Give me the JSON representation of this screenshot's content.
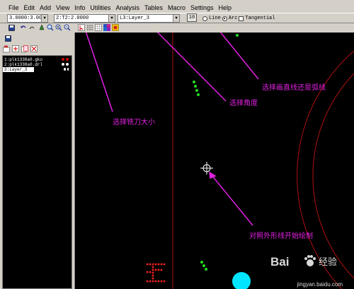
{
  "menu": {
    "items": [
      "File",
      "Edit",
      "Add",
      "View",
      "Info",
      "Utilities",
      "Analysis",
      "Tables",
      "Macro",
      "Settings",
      "Help"
    ]
  },
  "toolbar": {
    "aperture_value": "3.0000:3.0000",
    "tool_value": "2:T2:2.0000",
    "layer_value": "L3:Layer_3",
    "step_value": "10",
    "line_label": "Line",
    "arc_label": "Arc",
    "tangential_label": "Tangential",
    "selected_mode": "Arc",
    "tangential_checked": false
  },
  "layers": [
    {
      "label": "1:plk1338a0.gko",
      "selected": false,
      "dot_colors": [
        "#c00000",
        "#c00000"
      ]
    },
    {
      "label": "2:plk1338a0.drl",
      "selected": false,
      "dot_colors": [
        "#ffffff",
        "#ffffff"
      ]
    },
    {
      "label": "3:Layer_3",
      "selected": true,
      "dot_colors": [
        "#ffffff",
        "#ffffff"
      ]
    }
  ],
  "annotations": {
    "tool_size": "选择铣刀大小",
    "line_or_arc": "选择画直线还是弧线",
    "angle": "选择角度",
    "outline": "对照外形线开始绘制"
  },
  "watermark": {
    "site": "jingyan.baidu.com",
    "brand": "Baidu 经验"
  },
  "colors": {
    "annotation": "#e021e0",
    "outline": "#b01010",
    "drill_dots": "#22dd22",
    "pad": "#00e5ff",
    "text_glyph": "#e02020"
  }
}
